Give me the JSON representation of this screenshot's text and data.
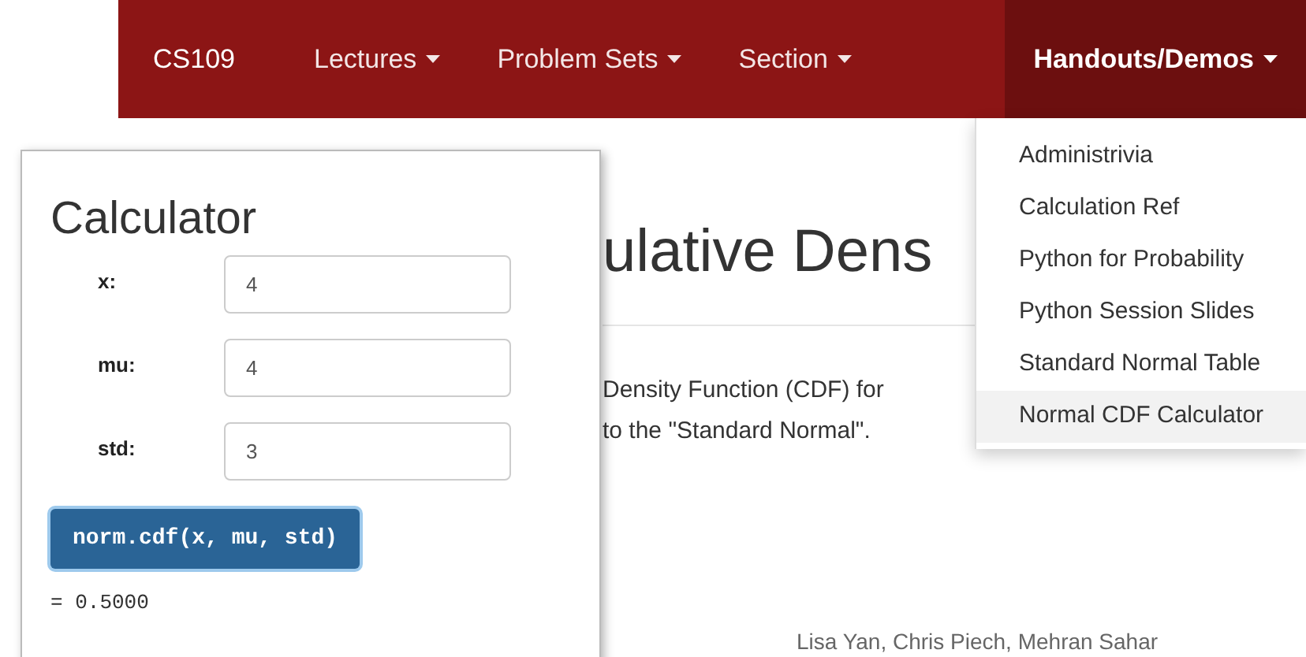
{
  "navbar": {
    "brand": "CS109",
    "items": [
      {
        "label": "Lectures",
        "selected": false
      },
      {
        "label": "Problem Sets",
        "selected": false
      },
      {
        "label": "Section",
        "selected": false
      },
      {
        "label": "Handouts/Demos",
        "selected": true
      }
    ]
  },
  "dropdown": [
    {
      "label": "Administrivia",
      "selected": false
    },
    {
      "label": "Calculation Ref",
      "selected": false
    },
    {
      "label": "Python for Probability",
      "selected": false
    },
    {
      "label": "Python Session Slides",
      "selected": false
    },
    {
      "label": "Standard Normal Table",
      "selected": false
    },
    {
      "label": "Normal CDF Calculator",
      "selected": true
    }
  ],
  "page": {
    "heading": "ulative Dens",
    "paragraph_lines": [
      "Density Function (CDF) for",
      "to the \"Standard Normal\"."
    ],
    "footer": "Lisa Yan, Chris Piech, Mehran Sahar"
  },
  "calculator": {
    "title": "Calculator",
    "fields": [
      {
        "label": "x:",
        "value": "4"
      },
      {
        "label": "mu:",
        "value": "4"
      },
      {
        "label": "std:",
        "value": "3"
      }
    ],
    "button": "norm.cdf(x, mu, std)",
    "result": "= 0.5000"
  }
}
